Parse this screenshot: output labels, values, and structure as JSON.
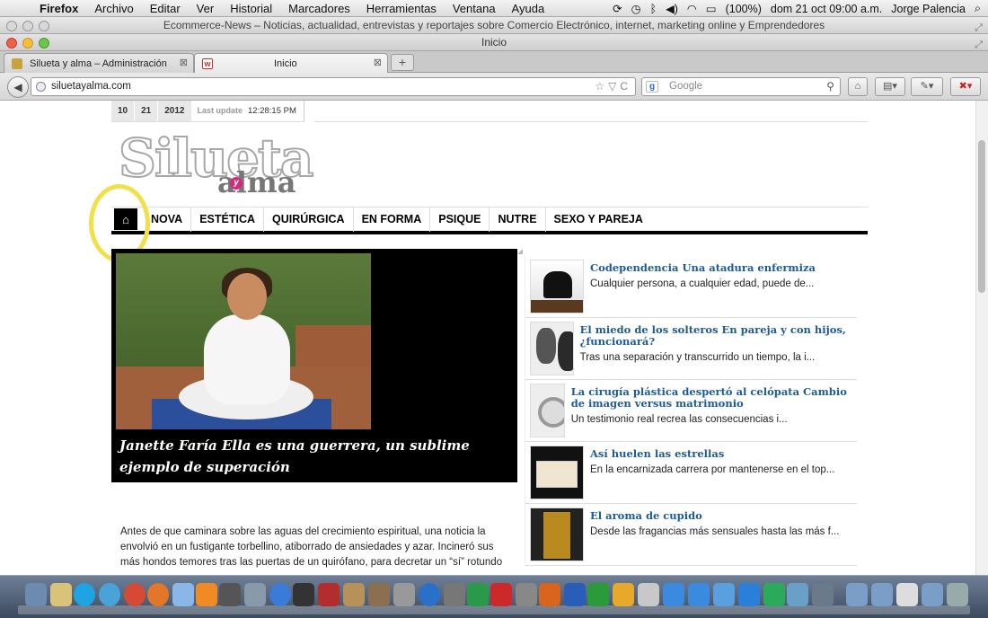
{
  "menubar": {
    "app": "Firefox",
    "items": [
      "Archivo",
      "Editar",
      "Ver",
      "Historial",
      "Marcadores",
      "Herramientas",
      "Ventana",
      "Ayuda"
    ],
    "battery": "(100%)",
    "clock": "dom 21 oct  09:00 a.m.",
    "user": "Jorge Palencia"
  },
  "window_back": {
    "title": "Ecommerce-News – Noticias, actualidad, entrevistas y reportajes sobre Comercio Electrónico, internet, marketing online y Emprendedores"
  },
  "window_front": {
    "title": "Inicio"
  },
  "tabs": [
    {
      "label": "Silueta y alma – Administración",
      "favicon_color": "#c8a23a"
    },
    {
      "label": "Inicio",
      "favicon_color": "#d42a2a"
    }
  ],
  "toolbar": {
    "url": "siluetayalma.com",
    "search_placeholder": "Google"
  },
  "site": {
    "date": {
      "day": "10",
      "month": "21",
      "year": "2012",
      "last_update_label": "Last update",
      "last_update_time": "12:28:15 PM"
    },
    "logo": {
      "main": "Silueta",
      "y": "y",
      "sub": "alma"
    },
    "nav": [
      "NOVA",
      "ESTÉTICA",
      "QUIRÚRGICA",
      "EN FORMA",
      "PSIQUE",
      "NUTRE",
      "SEXO Y PAREJA"
    ],
    "feature": {
      "caption": "Janette Faría Ella es una guerrera, un sublime ejemplo de superación"
    },
    "article": {
      "text": "Antes de que caminara sobre las aguas del crecimiento espiritual, una noticia la envolvió en un fustigante torbellino, atiborrado de ansiedades y azar. Incineró sus más hondos temores tras las puertas de un quirófano, para decretar un “sí” rotundo"
    },
    "sidebar": [
      {
        "title": "Codependencia Una atadura enfermiza",
        "excerpt": "Cualquier persona, a cualquier edad, puede  de..."
      },
      {
        "title": "El miedo de los solteros En pareja y con hijos, ¿funcionará?",
        "excerpt": "Tras una separación y transcurrido un tiempo, la i..."
      },
      {
        "title": "La cirugía plástica despertó al celópata Cambio de imagen versus matrimonio",
        "excerpt": "Un testimonio real recrea las consecuencias  i..."
      },
      {
        "title": "Así huelen las estrellas",
        "excerpt": "En la encarnizada carrera por mantenerse en el top..."
      },
      {
        "title": "El aroma de cupido",
        "excerpt": "Desde las fragancias más sensuales hasta las más f..."
      }
    ]
  },
  "highlight_color": "#f2e04a",
  "link_color": "#1d5b95"
}
